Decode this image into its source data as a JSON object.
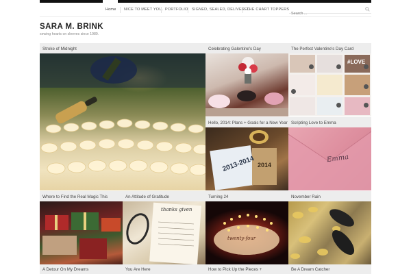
{
  "nav": {
    "items": [
      "Home",
      "NICE TO MEET YOU.",
      "PORTFOLIO",
      "SIGNED, SEALED, DELIVERED",
      "THE CHART TOPPERS"
    ],
    "search_placeholder": "Search ..."
  },
  "site": {
    "title": "SARA M. BRINK",
    "tagline": "sewing hearts on sleeves since 1989."
  },
  "tiles": [
    "Stroke of Midnight",
    "Celebrating Galentine's Day",
    "The Perfect Valentine's Day Card",
    "Hello, 2014: Plans + Goals for a New Year",
    "Scripting Love to Emma",
    "Where to Find the Real Magic This",
    "An Attitude of Gratitude",
    "Turning 24",
    "November Rain"
  ],
  "bottom_row": [
    "A Detour On My Dreams",
    "You Are Here",
    "How to Pick Up the Pieces +",
    "Be A Dream Catcher"
  ],
  "image_text": {
    "planner": "2013-2014",
    "planner_cover": "2014",
    "envelope": "Emma",
    "journal": "thanks given",
    "love_card": "#LOVE",
    "cake": "twenty-four"
  },
  "colors": {
    "header_bar": "#111111",
    "tile_label_bg": "#ededed",
    "envelope_pink": "#e8a6b2"
  }
}
